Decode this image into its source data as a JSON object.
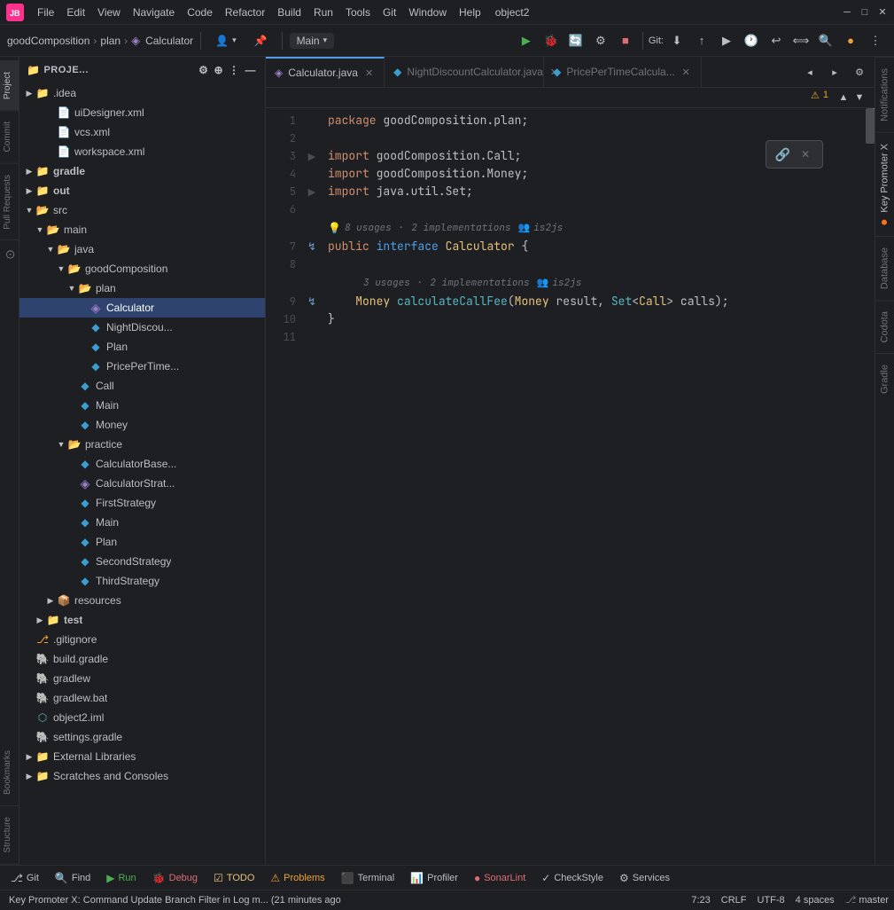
{
  "app": {
    "title": "object2",
    "logo": "JB"
  },
  "menu": {
    "items": [
      "File",
      "Edit",
      "View",
      "Navigate",
      "Code",
      "Refactor",
      "Build",
      "Run",
      "Tools",
      "Git",
      "Window",
      "Help"
    ]
  },
  "toolbar": {
    "breadcrumbs": [
      "goodComposition",
      "plan",
      "Calculator"
    ],
    "branch": "Main",
    "git_label": "Git:",
    "user_icon": "👤"
  },
  "tabs": [
    {
      "id": "calc",
      "label": "Calculator.java",
      "active": true,
      "icon": "◈"
    },
    {
      "id": "nightdisc",
      "label": "NightDiscountCalculator.java",
      "active": false,
      "icon": "◆"
    },
    {
      "id": "pricepertime",
      "label": "PricePerTimeCalcula...",
      "active": false,
      "icon": "◆"
    }
  ],
  "editor": {
    "filename": "Calculator.java",
    "warning_count": "1",
    "lines": [
      {
        "num": 1,
        "fold": "",
        "content": "package goodComposition.plan;"
      },
      {
        "num": 2,
        "fold": "",
        "content": ""
      },
      {
        "num": 3,
        "fold": "▶",
        "content": "import goodComposition.Call;"
      },
      {
        "num": 4,
        "fold": "",
        "content": "import goodComposition.Money;"
      },
      {
        "num": 5,
        "fold": "▶",
        "content": "import java.util.Set;"
      },
      {
        "num": 6,
        "fold": "",
        "content": ""
      },
      {
        "num": 7,
        "fold": "",
        "content": "public interface Calculator {",
        "hint": {
          "usages": "8 usages",
          "implementations": "2 implementations",
          "users": "is2js",
          "hint_line": true
        }
      },
      {
        "num": 8,
        "fold": "",
        "content": ""
      },
      {
        "num": 9,
        "fold": "",
        "content": "    Money calculateCallFee(Money result, Set<Call> calls);",
        "hint": {
          "usages": "3 usages",
          "implementations": "2 implementations",
          "users": "is2js",
          "hint_line": true
        }
      },
      {
        "num": 10,
        "fold": "",
        "content": "}"
      },
      {
        "num": 11,
        "fold": "",
        "content": ""
      }
    ]
  },
  "tree": {
    "items": [
      {
        "id": "proj-root",
        "label": "Proje...",
        "indent": 0,
        "icon": "folder",
        "arrow": "▶",
        "type": "folder"
      },
      {
        "id": "uidesigner",
        "label": "uiDesigner.xml",
        "indent": 2,
        "icon": "xml",
        "arrow": "",
        "type": "file"
      },
      {
        "id": "vcs",
        "label": "vcs.xml",
        "indent": 2,
        "icon": "xml",
        "arrow": "",
        "type": "file"
      },
      {
        "id": "workspace",
        "label": "workspace.xml",
        "indent": 2,
        "icon": "xml",
        "arrow": "",
        "type": "file"
      },
      {
        "id": "gradle",
        "label": "gradle",
        "indent": 1,
        "icon": "folder-yellow",
        "arrow": "▶",
        "type": "folder"
      },
      {
        "id": "out",
        "label": "out",
        "indent": 1,
        "icon": "folder-yellow-open",
        "arrow": "▶",
        "type": "folder",
        "selected": false
      },
      {
        "id": "src",
        "label": "src",
        "indent": 1,
        "icon": "folder-open",
        "arrow": "▼",
        "type": "folder"
      },
      {
        "id": "main",
        "label": "main",
        "indent": 2,
        "icon": "folder-open",
        "arrow": "▼",
        "type": "folder"
      },
      {
        "id": "java",
        "label": "java",
        "indent": 3,
        "icon": "folder-open",
        "arrow": "▼",
        "type": "folder"
      },
      {
        "id": "goodComposition",
        "label": "goodComposition",
        "indent": 4,
        "icon": "folder-open",
        "arrow": "▼",
        "type": "folder"
      },
      {
        "id": "plan",
        "label": "plan",
        "indent": 5,
        "icon": "folder-open",
        "arrow": "▼",
        "type": "folder"
      },
      {
        "id": "Calculator",
        "label": "Calculator",
        "indent": 6,
        "icon": "java-interface",
        "arrow": "",
        "type": "file",
        "selected": true
      },
      {
        "id": "NightDiscount",
        "label": "NightDiscou...",
        "indent": 6,
        "icon": "java",
        "arrow": "",
        "type": "file"
      },
      {
        "id": "Plan",
        "label": "Plan",
        "indent": 6,
        "icon": "java",
        "arrow": "",
        "type": "file"
      },
      {
        "id": "PricePerTime",
        "label": "PricePerTime...",
        "indent": 6,
        "icon": "java",
        "arrow": "",
        "type": "file"
      },
      {
        "id": "Call",
        "label": "Call",
        "indent": 5,
        "icon": "java",
        "arrow": "",
        "type": "file"
      },
      {
        "id": "Main",
        "label": "Main",
        "indent": 5,
        "icon": "java",
        "arrow": "",
        "type": "file"
      },
      {
        "id": "Money",
        "label": "Money",
        "indent": 5,
        "icon": "java",
        "arrow": "",
        "type": "file"
      },
      {
        "id": "practice",
        "label": "practice",
        "indent": 4,
        "icon": "folder-open",
        "arrow": "▼",
        "type": "folder"
      },
      {
        "id": "CalculatorBase",
        "label": "CalculatorBase...",
        "indent": 5,
        "icon": "java",
        "arrow": "",
        "type": "file"
      },
      {
        "id": "CalculatorStrat",
        "label": "CalculatorStrat...",
        "indent": 5,
        "icon": "java-interface",
        "arrow": "",
        "type": "file"
      },
      {
        "id": "FirstStrategy",
        "label": "FirstStrategy",
        "indent": 5,
        "icon": "java",
        "arrow": "",
        "type": "file"
      },
      {
        "id": "Main2",
        "label": "Main",
        "indent": 5,
        "icon": "java",
        "arrow": "",
        "type": "file"
      },
      {
        "id": "Plan2",
        "label": "Plan",
        "indent": 5,
        "icon": "java",
        "arrow": "",
        "type": "file"
      },
      {
        "id": "SecondStrategy",
        "label": "SecondStrategy",
        "indent": 5,
        "icon": "java",
        "arrow": "",
        "type": "file"
      },
      {
        "id": "ThirdStrategy",
        "label": "ThirdStrategy",
        "indent": 5,
        "icon": "java",
        "arrow": "",
        "type": "file"
      },
      {
        "id": "resources",
        "label": "resources",
        "indent": 3,
        "icon": "resources",
        "arrow": "▶",
        "type": "folder"
      },
      {
        "id": "test",
        "label": "test",
        "indent": 2,
        "icon": "folder-yellow-open",
        "arrow": "▶",
        "type": "folder"
      },
      {
        "id": "gitignore",
        "label": ".gitignore",
        "indent": 1,
        "icon": "git",
        "arrow": "",
        "type": "file"
      },
      {
        "id": "buildgradle",
        "label": "build.gradle",
        "indent": 1,
        "icon": "gradle",
        "arrow": "",
        "type": "file"
      },
      {
        "id": "gradlew",
        "label": "gradlew",
        "indent": 1,
        "icon": "gradle",
        "arrow": "",
        "type": "file"
      },
      {
        "id": "gradlewbat",
        "label": "gradlew.bat",
        "indent": 1,
        "icon": "gradle",
        "arrow": "",
        "type": "file"
      },
      {
        "id": "object2iml",
        "label": "object2.iml",
        "indent": 1,
        "icon": "iml",
        "arrow": "",
        "type": "file"
      },
      {
        "id": "settingsgradle",
        "label": "settings.gradle",
        "indent": 1,
        "icon": "gradle",
        "arrow": "",
        "type": "file"
      },
      {
        "id": "ext-lib",
        "label": "External Libraries",
        "indent": 0,
        "icon": "folder-purple",
        "arrow": "▶",
        "type": "folder"
      },
      {
        "id": "scratches",
        "label": "Scratches and Consoles",
        "indent": 0,
        "icon": "folder-yellow",
        "arrow": "▶",
        "type": "folder"
      }
    ]
  },
  "right_sidebar": {
    "items": [
      {
        "id": "notifications",
        "label": "Notifications",
        "active": false
      },
      {
        "id": "key-promoter",
        "label": "Key Promoter X",
        "active": true,
        "dot_color": "#f97316"
      },
      {
        "id": "database",
        "label": "Database",
        "active": false
      },
      {
        "id": "codota",
        "label": "Codota",
        "active": false
      },
      {
        "id": "gradle",
        "label": "Gradle",
        "active": false
      }
    ]
  },
  "left_sidebar": {
    "items": [
      {
        "id": "project",
        "label": "Project",
        "active": true
      },
      {
        "id": "commit",
        "label": "Commit",
        "active": false
      },
      {
        "id": "pull-requests",
        "label": "Pull Requests",
        "active": false
      },
      {
        "id": "github",
        "label": "GitHub",
        "active": false
      },
      {
        "id": "bookmarks",
        "label": "Bookmarks",
        "active": false
      },
      {
        "id": "structure",
        "label": "Structure",
        "active": false
      }
    ]
  },
  "bottom_toolbar": {
    "items": [
      {
        "id": "git",
        "label": "Git",
        "icon": "⎇"
      },
      {
        "id": "find",
        "label": "Find",
        "icon": "🔍"
      },
      {
        "id": "run",
        "label": "Run",
        "icon": "▶"
      },
      {
        "id": "debug",
        "label": "Debug",
        "icon": "🐛"
      },
      {
        "id": "todo",
        "label": "TODO",
        "icon": "☑"
      },
      {
        "id": "problems",
        "label": "Problems",
        "icon": "⚠"
      },
      {
        "id": "terminal",
        "label": "Terminal",
        "icon": "⬛"
      },
      {
        "id": "profiler",
        "label": "Profiler",
        "icon": "📊"
      },
      {
        "id": "sonar",
        "label": "SonarLint",
        "icon": "●"
      },
      {
        "id": "checkstyle",
        "label": "CheckStyle",
        "icon": "✓"
      },
      {
        "id": "services",
        "label": "Services",
        "icon": "⚙"
      }
    ]
  },
  "status_bar": {
    "message": "Key Promoter X: Command Update Branch Filter in Log m... (21 minutes ago",
    "position": "7:23",
    "encoding": "CRLF",
    "charset": "UTF-8",
    "indent": "4 spaces",
    "branch": "master"
  },
  "inline_popup": {
    "icon": "🔗"
  }
}
